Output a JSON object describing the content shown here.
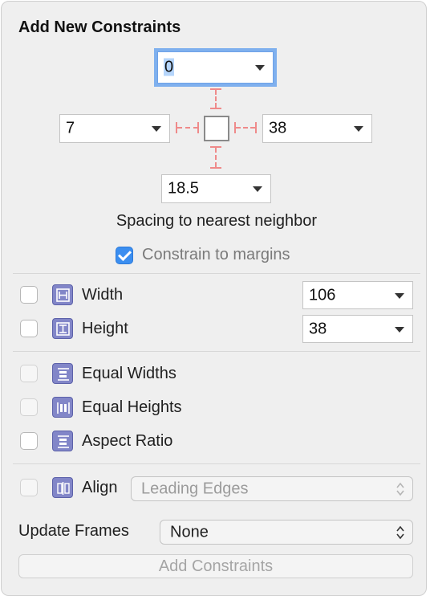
{
  "popover": {
    "title": "Add New Constraints",
    "spacing": {
      "top": "0",
      "left": "7",
      "right": "38",
      "bottom": "18.5"
    },
    "spacing_caption": "Spacing to nearest neighbor",
    "constrain_margins": {
      "label": "Constrain to margins",
      "checked": true
    },
    "size": [
      {
        "label": "Width",
        "value": "106",
        "checked": false,
        "icon": "width-icon"
      },
      {
        "label": "Height",
        "value": "38",
        "checked": false,
        "icon": "height-icon"
      }
    ],
    "equal": [
      {
        "label": "Equal Widths",
        "icon": "equal-widths-icon",
        "enabled": false
      },
      {
        "label": "Equal Heights",
        "icon": "equal-heights-icon",
        "enabled": false
      },
      {
        "label": "Aspect Ratio",
        "icon": "aspect-ratio-icon",
        "enabled": true
      }
    ],
    "align": {
      "label": "Align",
      "value": "Leading Edges",
      "icon": "align-icon"
    },
    "update_frames": {
      "label": "Update Frames",
      "value": "None"
    },
    "add_button": "Add Constraints"
  },
  "colors": {
    "accent": "#3b8ef0",
    "focus": "#7fb0ee",
    "strut": "#ef8a8a",
    "icon": "#8286c8"
  }
}
